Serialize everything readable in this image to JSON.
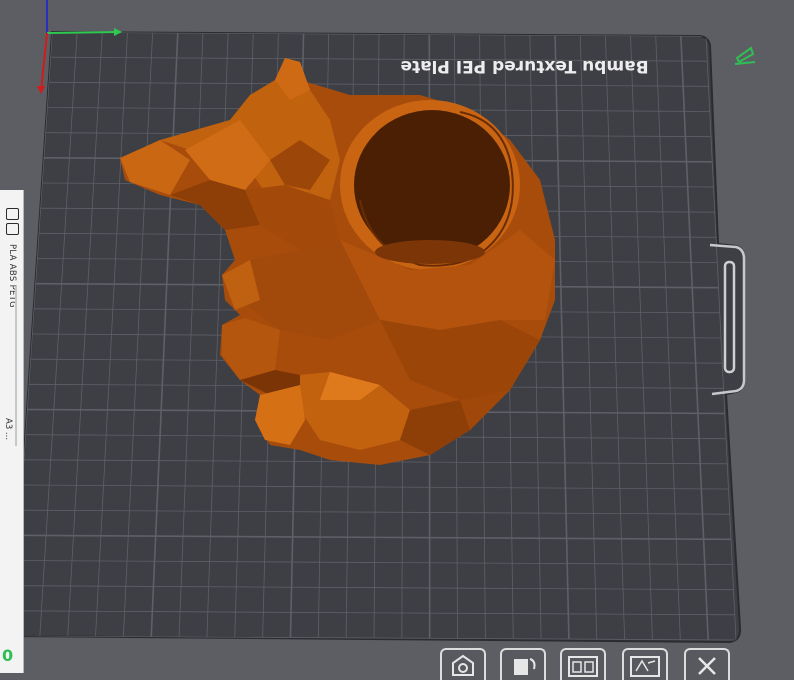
{
  "plate": {
    "name": "Bambu Textured PEI Plate",
    "filament_types": "PLA ABS PETG",
    "secondary_text": "A3 ..."
  },
  "model": {
    "name": "low-poly bear planter",
    "color": "#b8540f"
  },
  "colors": {
    "background": "#5d5e64",
    "plate": "#3e3f45",
    "grid": "#5e5f66",
    "axis_x": "#22c55e",
    "axis_y": "#1f2db3",
    "axis_z": "#d21b1b",
    "accent": "#2fbe53"
  },
  "toolbar": {
    "buttons": [
      {
        "name": "home-view-button",
        "icon": "home-icon"
      },
      {
        "name": "orient-button",
        "icon": "orient-icon"
      },
      {
        "name": "arrange-button",
        "icon": "arrange-icon"
      },
      {
        "name": "auto-orient-button",
        "icon": "auto-icon"
      },
      {
        "name": "close-button",
        "icon": "close-icon"
      }
    ]
  },
  "corner_label": "0"
}
